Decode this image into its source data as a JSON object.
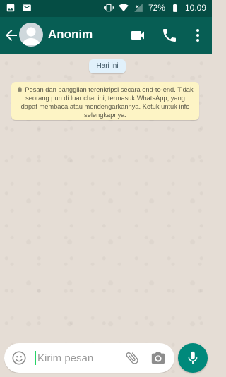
{
  "status_bar": {
    "battery": "72%",
    "time": "10.09"
  },
  "header": {
    "contact_name": "Anonim"
  },
  "chat": {
    "date_chip": "Hari ini",
    "encryption_notice": "Pesan dan panggilan terenkripsi secara end-to-end. Tidak seorang pun di luar chat ini, termasuk WhatsApp, yang dapat membaca atau mendengarkannya. Ketuk untuk info selengkapnya."
  },
  "composer": {
    "placeholder": "Kirim pesan"
  },
  "icons": {
    "status_left": [
      "image-icon",
      "gmail-icon"
    ],
    "status_right": [
      "vibrate-icon",
      "wifi-icon",
      "no-signal-icon",
      "battery-icon"
    ],
    "header": [
      "back-arrow-icon",
      "avatar-icon",
      "video-call-icon",
      "phone-icon",
      "more-vert-icon"
    ],
    "composer": [
      "emoji-icon",
      "attach-icon",
      "camera-icon",
      "mic-icon"
    ]
  },
  "colors": {
    "status_bar": "#054d44",
    "app_bar": "#075e54",
    "chat_background": "#e5ddd5",
    "date_chip": "#e1f1fb",
    "encryption_notice": "#fdf4c5",
    "mic_button": "#00897b",
    "caret": "#25d366"
  }
}
